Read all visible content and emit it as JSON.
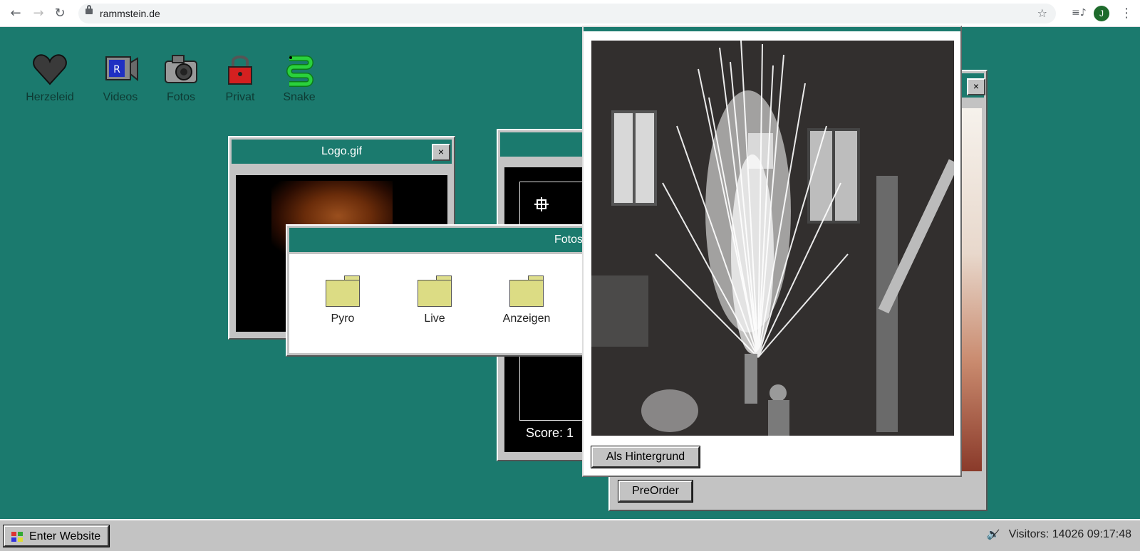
{
  "browser": {
    "url": "rammstein.de",
    "profile_initial": "J"
  },
  "desktop_icons": [
    {
      "label": "Herzeleid",
      "icon": "heart-icon"
    },
    {
      "label": "Videos",
      "icon": "video-camera-icon"
    },
    {
      "label": "Fotos",
      "icon": "photo-camera-icon"
    },
    {
      "label": "Privat",
      "icon": "padlock-icon"
    },
    {
      "label": "Snake",
      "icon": "snake-icon"
    }
  ],
  "windows": {
    "logo": {
      "title": "Logo.gif",
      "close": "×"
    },
    "snake": {
      "score_text": "Score: 1"
    },
    "fotos": {
      "title": "Fotos",
      "folders": [
        "Pyro",
        "Live",
        "Anzeigen"
      ]
    },
    "photo": {
      "button": "Als Hintergrund"
    },
    "shop": {
      "close": "×",
      "button": "PreOrder"
    }
  },
  "taskbar": {
    "start_label": "Enter Website",
    "visitors": "Visitors: 14026",
    "time": "09:17:48"
  },
  "colors": {
    "desktop": "#1b7a6e",
    "titlebar": "#1b7a6e",
    "window_face": "#c3c3c3"
  }
}
